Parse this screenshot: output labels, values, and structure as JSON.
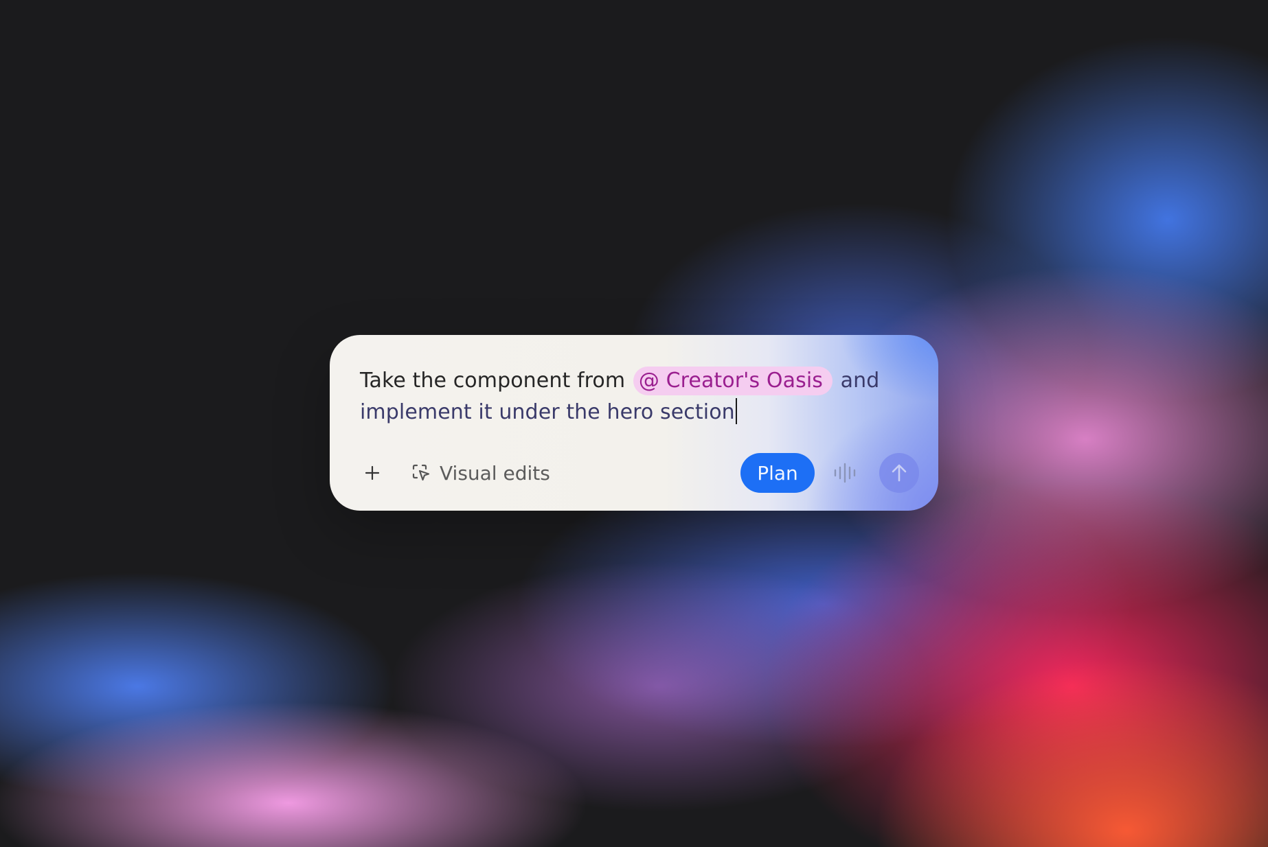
{
  "composer": {
    "prompt_before": "Take the component from ",
    "mention": "@ Creator's Oasis",
    "prompt_after": " and implement it under the hero section"
  },
  "toolbar": {
    "add_icon": "plus-icon",
    "visual_edits_icon": "cursor-select-icon",
    "visual_edits_label": "Visual edits",
    "plan_label": "Plan",
    "voice_icon": "waveform-icon",
    "send_icon": "arrow-up-icon"
  },
  "colors": {
    "plan_button": "#1d6ff5",
    "mention_bg": "#f5cdf0",
    "mention_text": "#9a1f8f"
  }
}
